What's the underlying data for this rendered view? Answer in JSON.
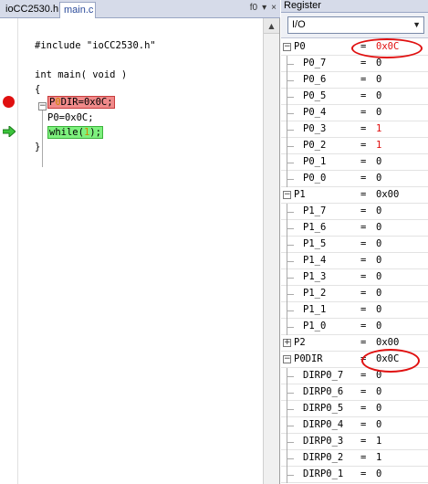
{
  "editor": {
    "tabs": [
      {
        "label": "ioCC2530.h",
        "active": false
      },
      {
        "label": "main.c",
        "active": true
      }
    ],
    "function_dropdown": "f0",
    "code_lines": [
      "#include \"ioCC2530.h\"",
      "",
      "int main( void )",
      "{",
      "P0DIR=0x0C;",
      "P0=0x0C;",
      "while(1);",
      "}"
    ],
    "breakpoint_line": 5,
    "current_line": 7
  },
  "register_window": {
    "title": "Register",
    "group_select": "I/O",
    "rows": [
      {
        "name": "P0",
        "value": "0x0C",
        "level": 0,
        "expander": "minus",
        "value_changed": true
      },
      {
        "name": "P0_7",
        "value": "0",
        "level": 1
      },
      {
        "name": "P0_6",
        "value": "0",
        "level": 1
      },
      {
        "name": "P0_5",
        "value": "0",
        "level": 1
      },
      {
        "name": "P0_4",
        "value": "0",
        "level": 1
      },
      {
        "name": "P0_3",
        "value": "1",
        "level": 1,
        "value_changed": true
      },
      {
        "name": "P0_2",
        "value": "1",
        "level": 1,
        "value_changed": true
      },
      {
        "name": "P0_1",
        "value": "0",
        "level": 1
      },
      {
        "name": "P0_0",
        "value": "0",
        "level": 1
      },
      {
        "name": "P1",
        "value": "0x00",
        "level": 0,
        "expander": "minus"
      },
      {
        "name": "P1_7",
        "value": "0",
        "level": 1
      },
      {
        "name": "P1_6",
        "value": "0",
        "level": 1
      },
      {
        "name": "P1_5",
        "value": "0",
        "level": 1
      },
      {
        "name": "P1_4",
        "value": "0",
        "level": 1
      },
      {
        "name": "P1_3",
        "value": "0",
        "level": 1
      },
      {
        "name": "P1_2",
        "value": "0",
        "level": 1
      },
      {
        "name": "P1_1",
        "value": "0",
        "level": 1
      },
      {
        "name": "P1_0",
        "value": "0",
        "level": 1
      },
      {
        "name": "P2",
        "value": "0x00",
        "level": 0,
        "expander": "plus"
      },
      {
        "name": "P0DIR",
        "value": "0x0C",
        "level": 0,
        "expander": "minus"
      },
      {
        "name": "DIRP0_7",
        "value": "0",
        "level": 1
      },
      {
        "name": "DIRP0_6",
        "value": "0",
        "level": 1
      },
      {
        "name": "DIRP0_5",
        "value": "0",
        "level": 1
      },
      {
        "name": "DIRP0_4",
        "value": "0",
        "level": 1
      },
      {
        "name": "DIRP0_3",
        "value": "1",
        "level": 1
      },
      {
        "name": "DIRP0_2",
        "value": "1",
        "level": 1
      },
      {
        "name": "DIRP0_1",
        "value": "0",
        "level": 1
      }
    ]
  },
  "colors": {
    "changed_value": "#e01010",
    "breakpoint": "#e01010",
    "current_statement": "#7ef07e",
    "breakpoint_highlight": "#f08a8a",
    "annotation": "#e01010"
  }
}
